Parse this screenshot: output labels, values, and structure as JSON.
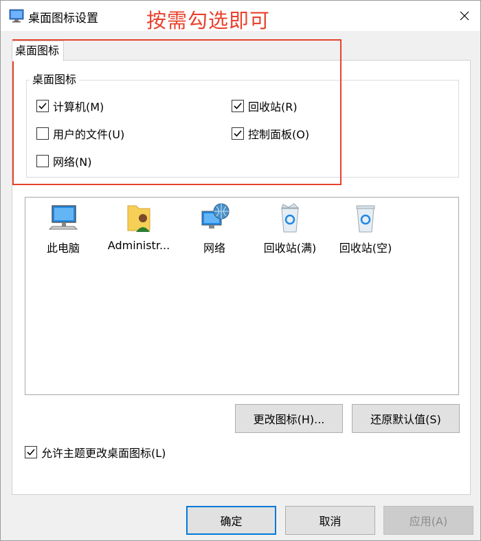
{
  "window": {
    "title": "桌面图标设置",
    "annotation": "按需勾选即可"
  },
  "tab": {
    "label": "桌面图标"
  },
  "group": {
    "legend": "桌面图标",
    "checkboxes": [
      {
        "label": "计算机(M)",
        "checked": true
      },
      {
        "label": "回收站(R)",
        "checked": true
      },
      {
        "label": "用户的文件(U)",
        "checked": false
      },
      {
        "label": "控制面板(O)",
        "checked": true
      },
      {
        "label": "网络(N)",
        "checked": false
      }
    ]
  },
  "icons": [
    {
      "label": "此电脑",
      "icon": "computer-icon"
    },
    {
      "label": "Administr...",
      "icon": "user-folder-icon"
    },
    {
      "label": "网络",
      "icon": "network-icon"
    },
    {
      "label": "回收站(满)",
      "icon": "recycle-bin-full-icon"
    },
    {
      "label": "回收站(空)",
      "icon": "recycle-bin-empty-icon"
    }
  ],
  "buttons": {
    "change_icon": "更改图标(H)...",
    "restore_default": "还原默认值(S)",
    "ok": "确定",
    "cancel": "取消",
    "apply": "应用(A)"
  },
  "allow_theme": {
    "label": "允许主题更改桌面图标(L)",
    "checked": true
  },
  "colors": {
    "annotation": "#e8412c",
    "focus": "#0078d7"
  }
}
